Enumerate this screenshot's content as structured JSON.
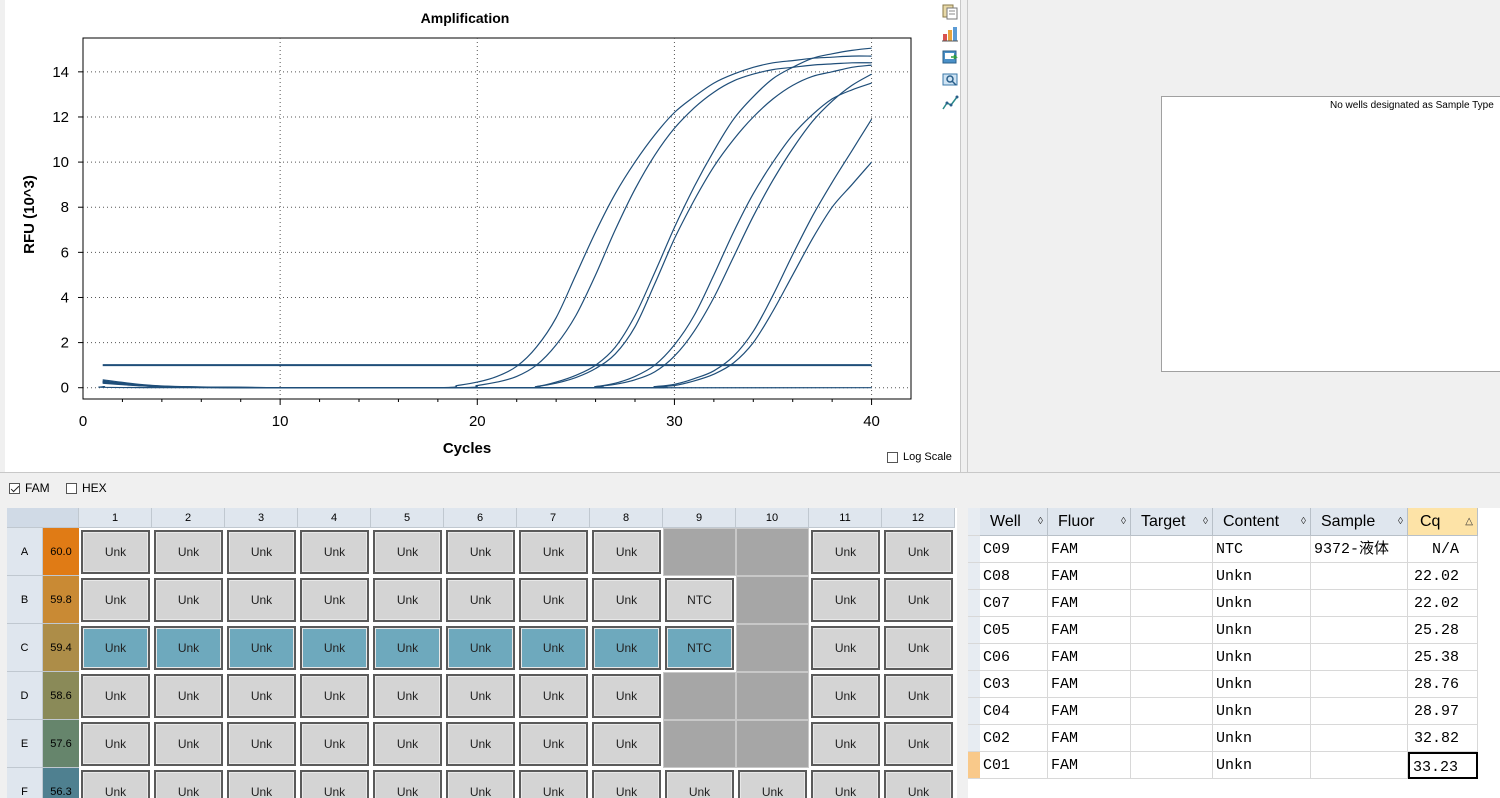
{
  "chart": {
    "title": "Amplification",
    "xlabel": "Cycles",
    "ylabel": "RFU (10^3)",
    "log_scale_label": "Log Scale",
    "log_scale_checked": false
  },
  "chart_data": {
    "type": "line",
    "title": "Amplification",
    "xlabel": "Cycles",
    "ylabel": "RFU (10^3)",
    "xlim": [
      0,
      42
    ],
    "ylim": [
      -0.5,
      15.5
    ],
    "xticks": [
      0,
      10,
      20,
      30,
      40
    ],
    "yticks": [
      0,
      2,
      4,
      6,
      8,
      10,
      12,
      14
    ],
    "threshold": 1.0,
    "grid": true,
    "line_color": "#1f4e79",
    "series": [
      {
        "values": [
          [
            1,
            0.3
          ],
          [
            3,
            0.12
          ],
          [
            5,
            0.04
          ],
          [
            10,
            0.0
          ],
          [
            18,
            0.0
          ],
          [
            19,
            0.1
          ],
          [
            20,
            0.25
          ],
          [
            21,
            0.5
          ],
          [
            22,
            0.95
          ],
          [
            23,
            1.8
          ],
          [
            24,
            3.1
          ],
          [
            25,
            5.0
          ],
          [
            26,
            6.9
          ],
          [
            27,
            8.6
          ],
          [
            28,
            10.0
          ],
          [
            29,
            11.2
          ],
          [
            30,
            12.2
          ],
          [
            31,
            12.9
          ],
          [
            32,
            13.5
          ],
          [
            33,
            13.9
          ],
          [
            34,
            14.2
          ],
          [
            35,
            14.4
          ],
          [
            36,
            14.5
          ],
          [
            37,
            14.6
          ],
          [
            38,
            14.65
          ],
          [
            39,
            14.7
          ],
          [
            40,
            14.7
          ]
        ]
      },
      {
        "values": [
          [
            1,
            0.25
          ],
          [
            3,
            0.1
          ],
          [
            5,
            0.03
          ],
          [
            10,
            0.0
          ],
          [
            19,
            0.0
          ],
          [
            20,
            0.1
          ],
          [
            21,
            0.25
          ],
          [
            22,
            0.5
          ],
          [
            23,
            1.0
          ],
          [
            24,
            1.9
          ],
          [
            25,
            3.2
          ],
          [
            26,
            5.0
          ],
          [
            27,
            7.0
          ],
          [
            28,
            8.8
          ],
          [
            29,
            10.3
          ],
          [
            30,
            11.5
          ],
          [
            31,
            12.4
          ],
          [
            32,
            13.1
          ],
          [
            33,
            13.6
          ],
          [
            34,
            13.9
          ],
          [
            35,
            14.1
          ],
          [
            36,
            14.2
          ],
          [
            37,
            14.3
          ],
          [
            38,
            14.35
          ],
          [
            39,
            14.4
          ],
          [
            40,
            14.4
          ]
        ]
      },
      {
        "values": [
          [
            1,
            0.35
          ],
          [
            3,
            0.14
          ],
          [
            5,
            0.05
          ],
          [
            10,
            0.0
          ],
          [
            22,
            0.0
          ],
          [
            23,
            0.05
          ],
          [
            24,
            0.2
          ],
          [
            25,
            0.45
          ],
          [
            26,
            0.85
          ],
          [
            27,
            1.5
          ],
          [
            28,
            2.7
          ],
          [
            29,
            4.6
          ],
          [
            30,
            6.6
          ],
          [
            31,
            8.3
          ],
          [
            32,
            9.8
          ],
          [
            33,
            11.0
          ],
          [
            34,
            12.0
          ],
          [
            35,
            12.8
          ],
          [
            36,
            13.4
          ],
          [
            37,
            13.8
          ],
          [
            38,
            14.0
          ],
          [
            39,
            14.2
          ],
          [
            40,
            14.3
          ]
        ]
      },
      {
        "values": [
          [
            1,
            0.28
          ],
          [
            3,
            0.11
          ],
          [
            5,
            0.04
          ],
          [
            10,
            0.0
          ],
          [
            22,
            0.0
          ],
          [
            23,
            0.05
          ],
          [
            24,
            0.25
          ],
          [
            25,
            0.55
          ],
          [
            26,
            1.0
          ],
          [
            27,
            1.8
          ],
          [
            28,
            3.2
          ],
          [
            29,
            5.1
          ],
          [
            30,
            7.1
          ],
          [
            31,
            8.9
          ],
          [
            32,
            10.5
          ],
          [
            33,
            11.9
          ],
          [
            34,
            12.9
          ],
          [
            35,
            13.7
          ],
          [
            36,
            14.2
          ],
          [
            37,
            14.6
          ],
          [
            38,
            14.8
          ],
          [
            39,
            14.95
          ],
          [
            40,
            15.05
          ]
        ]
      },
      {
        "values": [
          [
            1,
            0.22
          ],
          [
            3,
            0.09
          ],
          [
            5,
            0.03
          ],
          [
            10,
            0.0
          ],
          [
            25,
            0.0
          ],
          [
            26,
            0.05
          ],
          [
            27,
            0.2
          ],
          [
            28,
            0.5
          ],
          [
            29,
            1.0
          ],
          [
            30,
            1.9
          ],
          [
            31,
            3.2
          ],
          [
            32,
            5.0
          ],
          [
            33,
            6.9
          ],
          [
            34,
            8.6
          ],
          [
            35,
            10.0
          ],
          [
            36,
            11.2
          ],
          [
            37,
            12.1
          ],
          [
            38,
            12.8
          ],
          [
            39,
            13.2
          ],
          [
            40,
            13.5
          ]
        ]
      },
      {
        "values": [
          [
            1,
            0.2
          ],
          [
            3,
            0.08
          ],
          [
            5,
            0.02
          ],
          [
            10,
            0.0
          ],
          [
            25,
            0.0
          ],
          [
            26,
            0.05
          ],
          [
            27,
            0.15
          ],
          [
            28,
            0.35
          ],
          [
            29,
            0.7
          ],
          [
            30,
            1.4
          ],
          [
            31,
            2.5
          ],
          [
            32,
            4.0
          ],
          [
            33,
            5.8
          ],
          [
            34,
            7.6
          ],
          [
            35,
            9.2
          ],
          [
            36,
            10.6
          ],
          [
            37,
            11.8
          ],
          [
            38,
            12.7
          ],
          [
            39,
            13.4
          ],
          [
            40,
            13.9
          ]
        ]
      },
      {
        "values": [
          [
            1,
            0.26
          ],
          [
            3,
            0.1
          ],
          [
            5,
            0.03
          ],
          [
            10,
            0.0
          ],
          [
            28,
            0.0
          ],
          [
            29,
            0.05
          ],
          [
            30,
            0.15
          ],
          [
            31,
            0.4
          ],
          [
            32,
            0.75
          ],
          [
            33,
            1.4
          ],
          [
            34,
            2.5
          ],
          [
            35,
            4.1
          ],
          [
            36,
            5.9
          ],
          [
            37,
            7.6
          ],
          [
            38,
            9.1
          ],
          [
            39,
            10.5
          ],
          [
            40,
            11.9
          ]
        ]
      },
      {
        "values": [
          [
            1,
            0.24
          ],
          [
            3,
            0.09
          ],
          [
            5,
            0.03
          ],
          [
            10,
            0.0
          ],
          [
            28,
            0.0
          ],
          [
            29,
            0.05
          ],
          [
            30,
            0.1
          ],
          [
            31,
            0.3
          ],
          [
            32,
            0.6
          ],
          [
            33,
            1.1
          ],
          [
            34,
            2.0
          ],
          [
            35,
            3.4
          ],
          [
            36,
            5.0
          ],
          [
            37,
            6.6
          ],
          [
            38,
            8.0
          ],
          [
            39,
            9.0
          ],
          [
            40,
            10.0
          ]
        ]
      },
      {
        "values": [
          [
            1,
            0.05
          ],
          [
            5,
            0.0
          ],
          [
            40,
            0.0
          ]
        ]
      }
    ]
  },
  "toolbar": {
    "icons": [
      "copy-icon",
      "export-chart-icon",
      "save-image-icon",
      "print-preview-icon",
      "chart-options-icon"
    ]
  },
  "sample_panel": {
    "message": "No wells designated as Sample Type"
  },
  "fluor_filters": [
    {
      "label": "FAM",
      "checked": true
    },
    {
      "label": "HEX",
      "checked": false
    }
  ],
  "plate": {
    "columns": [
      "1",
      "2",
      "3",
      "4",
      "5",
      "6",
      "7",
      "8",
      "9",
      "10",
      "11",
      "12"
    ],
    "rows": [
      {
        "label": "A",
        "temp": "60.0",
        "temp_color": "#e07b15",
        "wells": [
          "Unk",
          "Unk",
          "Unk",
          "Unk",
          "Unk",
          "Unk",
          "Unk",
          "Unk",
          "",
          "",
          "Unk",
          "Unk"
        ],
        "types": [
          "unk",
          "unk",
          "unk",
          "unk",
          "unk",
          "unk",
          "unk",
          "unk",
          "empty",
          "empty",
          "unk",
          "unk"
        ]
      },
      {
        "label": "B",
        "temp": "59.8",
        "temp_color": "#c98a34",
        "wells": [
          "Unk",
          "Unk",
          "Unk",
          "Unk",
          "Unk",
          "Unk",
          "Unk",
          "Unk",
          "NTC",
          "",
          "Unk",
          "Unk"
        ],
        "types": [
          "unk",
          "unk",
          "unk",
          "unk",
          "unk",
          "unk",
          "unk",
          "unk",
          "unk",
          "empty",
          "unk",
          "unk"
        ]
      },
      {
        "label": "C",
        "temp": "59.4",
        "temp_color": "#ad8d48",
        "wells": [
          "Unk",
          "Unk",
          "Unk",
          "Unk",
          "Unk",
          "Unk",
          "Unk",
          "Unk",
          "NTC",
          "",
          "Unk",
          "Unk"
        ],
        "types": [
          "sel",
          "sel",
          "sel",
          "sel",
          "sel",
          "sel",
          "sel",
          "sel",
          "sel",
          "empty",
          "unk",
          "unk"
        ]
      },
      {
        "label": "D",
        "temp": "58.6",
        "temp_color": "#8a8a58",
        "wells": [
          "Unk",
          "Unk",
          "Unk",
          "Unk",
          "Unk",
          "Unk",
          "Unk",
          "Unk",
          "",
          "",
          "Unk",
          "Unk"
        ],
        "types": [
          "unk",
          "unk",
          "unk",
          "unk",
          "unk",
          "unk",
          "unk",
          "unk",
          "empty",
          "empty",
          "unk",
          "unk"
        ]
      },
      {
        "label": "E",
        "temp": "57.6",
        "temp_color": "#66856c",
        "wells": [
          "Unk",
          "Unk",
          "Unk",
          "Unk",
          "Unk",
          "Unk",
          "Unk",
          "Unk",
          "",
          "",
          "Unk",
          "Unk"
        ],
        "types": [
          "unk",
          "unk",
          "unk",
          "unk",
          "unk",
          "unk",
          "unk",
          "unk",
          "empty",
          "empty",
          "unk",
          "unk"
        ]
      },
      {
        "label": "F",
        "temp": "56.3",
        "temp_color": "#4f8090",
        "wells": [
          "Unk",
          "Unk",
          "Unk",
          "Unk",
          "Unk",
          "Unk",
          "Unk",
          "Unk",
          "Unk",
          "Unk",
          "Unk",
          "Unk"
        ],
        "types": [
          "unk",
          "unk",
          "unk",
          "unk",
          "unk",
          "unk",
          "unk",
          "unk",
          "unk",
          "unk",
          "unk",
          "unk"
        ]
      }
    ]
  },
  "results_table": {
    "headers": [
      "Well",
      "Fluor",
      "Target",
      "Content",
      "Sample",
      "Cq"
    ],
    "sort_column": "Cq",
    "rows": [
      [
        "C09",
        "FAM",
        "",
        "NTC",
        "9372-液体",
        "N/A"
      ],
      [
        "C08",
        "FAM",
        "",
        "Unkn",
        "",
        "22.02"
      ],
      [
        "C07",
        "FAM",
        "",
        "Unkn",
        "",
        "22.02"
      ],
      [
        "C05",
        "FAM",
        "",
        "Unkn",
        "",
        "25.28"
      ],
      [
        "C06",
        "FAM",
        "",
        "Unkn",
        "",
        "25.38"
      ],
      [
        "C03",
        "FAM",
        "",
        "Unkn",
        "",
        "28.76"
      ],
      [
        "C04",
        "FAM",
        "",
        "Unkn",
        "",
        "28.97"
      ],
      [
        "C02",
        "FAM",
        "",
        "Unkn",
        "",
        "32.82"
      ],
      [
        "C01",
        "FAM",
        "",
        "Unkn",
        "",
        "33.23"
      ]
    ]
  }
}
